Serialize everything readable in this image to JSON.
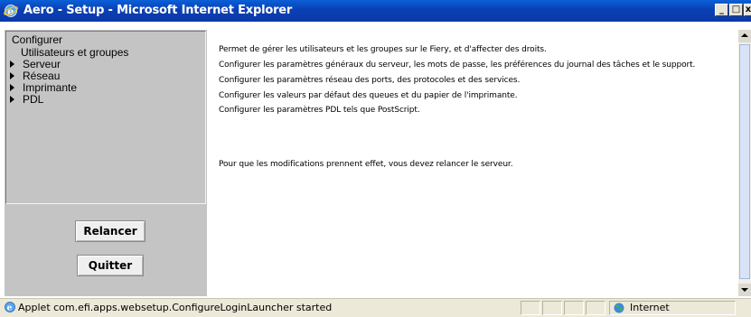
{
  "window": {
    "title": "Aero - Setup - Microsoft Internet Explorer",
    "buttons": {
      "minimize": "_",
      "maximize": "□",
      "close": "x"
    }
  },
  "menu": {
    "root": "Configurer",
    "selected": "Utilisateurs et groupes",
    "items": [
      {
        "label": "Serveur"
      },
      {
        "label": "Réseau"
      },
      {
        "label": "Imprimante"
      },
      {
        "label": "PDL"
      }
    ]
  },
  "actions": {
    "restart": "Relancer",
    "quit": "Quitter"
  },
  "content": {
    "descriptions": [
      "Permet de gérer les utilisateurs et les groupes sur le Fiery, et d'affecter des droits.",
      "Configurer les paramètres généraux du serveur, les mots de passe, les préférences du journal des tâches et le support.",
      "Configurer les paramètres réseau des ports, des protocoles et des services.",
      "Configurer les valeurs par défaut des queues et du papier de l'imprimante.",
      "Configurer les paramètres PDL tels que PostScript."
    ],
    "note": "Pour que les modifications prennent effet, vous devez relancer le serveur."
  },
  "status": {
    "text": "Applet com.efi.apps.websetup.ConfigureLoginLauncher started",
    "zone": "Internet"
  },
  "icons": {
    "title": "ie-icon",
    "status": "ie-page-icon",
    "zone": "globe-icon"
  },
  "colors": {
    "titlebar": "#0a3fb4",
    "panel": "#c4c4c4",
    "statusbar": "#ece9d8"
  }
}
